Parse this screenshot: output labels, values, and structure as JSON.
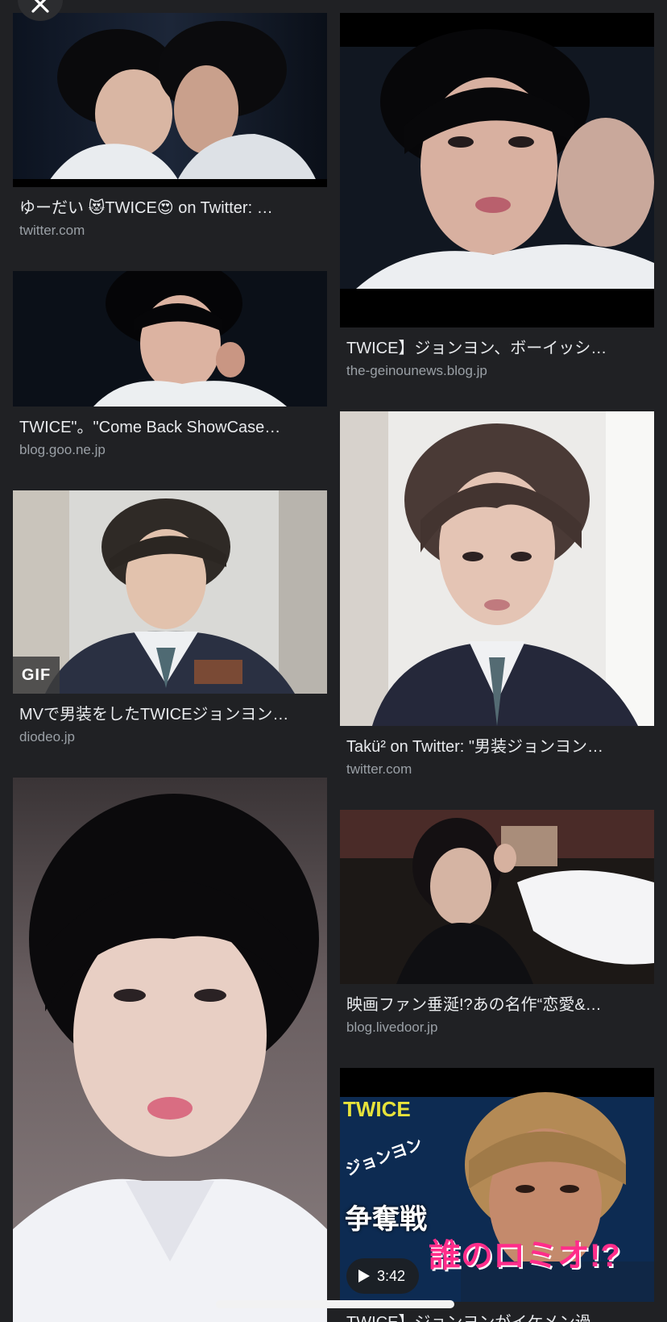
{
  "colors": {
    "background": "#202124",
    "caption_text": "#e8eaed",
    "source_text": "#9aa0a6",
    "twice_yellow": "#e7e23a",
    "overlay_pink": "#ff2d8a"
  },
  "close_icon": "close-icon",
  "results": [
    {
      "caption": "ゆーだい 😻TWICE😍 on Twitter: …",
      "source": "twitter.com"
    },
    {
      "caption": "TWICE\"。\"Come Back ShowCase…",
      "source": "blog.goo.ne.jp"
    },
    {
      "caption": "MVで男装をしたTWICEジョンヨン…",
      "source": "diodeo.jp",
      "badge": "GIF"
    },
    {
      "caption": "",
      "source": ""
    },
    {
      "caption": "TWICE】ジョンヨン、ボーイッシ…",
      "source": "the-geinounews.blog.jp"
    },
    {
      "caption": "Takü² on Twitter: \"男装ジョンヨン…",
      "source": "twitter.com"
    },
    {
      "caption": "映画ファン垂涎!?あの名作“恋愛&…",
      "source": "blog.livedoor.jp"
    },
    {
      "caption": "TWICE】ジョンヨンがイケメン過…",
      "source": "",
      "duration": "3:42",
      "overlay_brand": "TWICE",
      "overlay_name": "ジョンヨン",
      "overlay_battle": "争奪戦",
      "overlay_headline": "誰のロミオ!?"
    }
  ]
}
